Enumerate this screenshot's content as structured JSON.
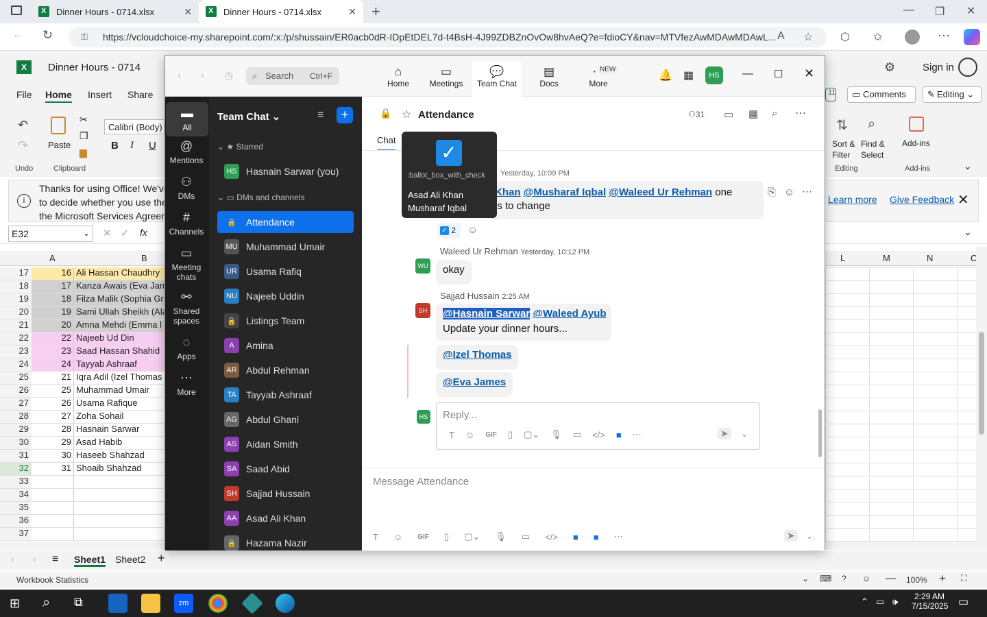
{
  "browser": {
    "tabs": [
      {
        "title": "Dinner Hours - 0714.xlsx"
      },
      {
        "title": "Dinner Hours - 0714.xlsx"
      }
    ],
    "url": "https://vcloudchoice-my.sharepoint.com/:x:/p/shussain/ER0acb0dR-IDpEtDEL7d-t4BsH-4J99ZDBZnOvOw8hvAeQ?e=fdioCY&nav=MTVfezAwMDAwMDAwL..."
  },
  "excel": {
    "title": "Dinner Hours - 0714",
    "signin": "Sign in",
    "menus": [
      "File",
      "Home",
      "Insert",
      "Share"
    ],
    "ribbon": {
      "undo": "Undo",
      "paste": "Paste",
      "clipboard": "Clipboard",
      "font": "Calibri (Body)",
      "sort_filter": "Sort & Filter",
      "find_select": "Find & Select",
      "editing_group": "Editing",
      "addins": "Add-ins",
      "addins_group": "Add-ins",
      "comments": "Comments",
      "editing": "Editing",
      "count_badge": "11"
    },
    "message": {
      "line1": "Thanks for using Office! We've",
      "line2": "to decide whether you use the",
      "line3": "the Microsoft Services Agreem",
      "learn_more": "Learn more",
      "feedback": "Give Feedback"
    },
    "namebox": "E32",
    "fx": "fx",
    "columns_left": [
      "A",
      "B"
    ],
    "columns_right": [
      "L",
      "M",
      "N",
      "C"
    ],
    "rows": [
      {
        "n": "17",
        "a": "16",
        "b": "Ali Hassan Chaudhry",
        "color": "#fde9a8"
      },
      {
        "n": "18",
        "a": "17",
        "b": "Kanza Awais (Eva Jam",
        "color": "#d0d0d0"
      },
      {
        "n": "19",
        "a": "18",
        "b": "Filza Malik (Sophia Gr",
        "color": "#d0d0d0"
      },
      {
        "n": "20",
        "a": "19",
        "b": "Sami Ullah Sheikh (Ala",
        "color": "#d0d0d0"
      },
      {
        "n": "21",
        "a": "20",
        "b": "Amna Mehdi (Emma l",
        "color": "#d0d0d0"
      },
      {
        "n": "22",
        "a": "22",
        "b": "Najeeb Ud Din",
        "color": "#f8cdf2"
      },
      {
        "n": "23",
        "a": "23",
        "b": "Saad Hassan Shahid",
        "color": "#f8cdf2"
      },
      {
        "n": "24",
        "a": "24",
        "b": "Tayyab Ashraaf",
        "color": "#f8cdf2"
      },
      {
        "n": "25",
        "a": "21",
        "b": "Iqra Adil (Izel Thomas",
        "color": "#ffffff"
      },
      {
        "n": "26",
        "a": "25",
        "b": "Muhammad Umair",
        "color": "#ffffff"
      },
      {
        "n": "27",
        "a": "26",
        "b": "Usama Rafique",
        "color": "#ffffff"
      },
      {
        "n": "28",
        "a": "27",
        "b": "Zoha Sohail",
        "color": "#ffffff"
      },
      {
        "n": "29",
        "a": "28",
        "b": "Hasnain Sarwar",
        "color": "#ffffff"
      },
      {
        "n": "30",
        "a": "29",
        "b": "Asad Habib",
        "color": "#ffffff"
      },
      {
        "n": "31",
        "a": "30",
        "b": "Haseeb Shahzad",
        "color": "#ffffff"
      },
      {
        "n": "32",
        "a": "31",
        "b": "Shoaib Shahzad",
        "color": "#ffffff"
      },
      {
        "n": "33",
        "a": "",
        "b": "",
        "color": "#ffffff"
      },
      {
        "n": "34",
        "a": "",
        "b": "",
        "color": "#ffffff"
      },
      {
        "n": "35",
        "a": "",
        "b": "",
        "color": "#ffffff"
      },
      {
        "n": "36",
        "a": "",
        "b": "",
        "color": "#ffffff"
      },
      {
        "n": "37",
        "a": "",
        "b": "",
        "color": "#ffffff"
      }
    ],
    "sheets": [
      "Sheet1",
      "Sheet2"
    ],
    "status": "Workbook Statistics",
    "zoom": "100%"
  },
  "zoom_app": {
    "search": "Search",
    "search_shortcut": "Ctrl+F",
    "nav": [
      "Home",
      "Meetings",
      "Team Chat",
      "Docs",
      "More"
    ],
    "new_badge": "NEW",
    "avatar": "HS",
    "rail": [
      "All",
      "Mentions",
      "DMs",
      "Channels",
      "Meeting chats",
      "Shared spaces",
      "Apps",
      "More"
    ],
    "list_title": "Team Chat",
    "starred_label": "Starred",
    "dms_label": "DMs and channels",
    "starred": [
      {
        "name": "Hasnain Sarwar (you)",
        "initials": "HS",
        "color": "#2e9e57"
      }
    ],
    "channels": [
      {
        "name": "Attendance",
        "initials": "",
        "color": "#0e71eb"
      },
      {
        "name": "Muhammad Umair",
        "initials": "MU",
        "color": "#555"
      },
      {
        "name": "Usama Rafiq",
        "initials": "UR",
        "color": "#3a5a86"
      },
      {
        "name": "Najeeb Uddin",
        "initials": "NU",
        "color": "#2a7fc4"
      },
      {
        "name": "Listings Team",
        "initials": "",
        "color": "#444"
      },
      {
        "name": "Amina",
        "initials": "A",
        "color": "#8b3fb0"
      },
      {
        "name": "Abdul Rehman",
        "initials": "AR",
        "color": "#7a5a40"
      },
      {
        "name": "Tayyab Ashraaf",
        "initials": "TA",
        "color": "#2a7fc4"
      },
      {
        "name": "Abdul Ghani",
        "initials": "AG",
        "color": "#666"
      },
      {
        "name": "Aidan Smith",
        "initials": "AS",
        "color": "#8b3fb0"
      },
      {
        "name": "Saad Abid",
        "initials": "SA",
        "color": "#8b3fb0"
      },
      {
        "name": "Sajjad Hussain",
        "initials": "SH",
        "color": "#c0392b"
      },
      {
        "name": "Asad Ali Khan",
        "initials": "AA",
        "color": "#8b3fb0"
      },
      {
        "name": "Hazama Nazir",
        "initials": "",
        "color": "#666"
      }
    ],
    "channel_title": "Attendance",
    "member_count": "31",
    "chat_tab": "Chat",
    "tooltip": {
      "code": ":ballot_box_with_check",
      "user1": "Asad Ali Khan",
      "user2": "Musharaf Iqbal"
    },
    "msg1": {
      "time": "Yesterday, 10:09 PM",
      "mention_a": "Khan",
      "mention_b": "@Musharaf Iqbal",
      "mention_c": "@Waleed Ur Rehman",
      "text_a": "one",
      "text_b": "ls to change",
      "reaction_count": "2"
    },
    "msg2": {
      "author": "Waleed Ur Rehman",
      "time": "Yesterday, 10:12 PM",
      "text": "okay",
      "initials": "WU"
    },
    "msg3": {
      "author": "Sajjad Hussain",
      "time": "2:25 AM",
      "initials": "SH",
      "mention_a": "@Hasnain Sarwar",
      "mention_b": "@Waleed Ayub",
      "text": "Update your dinner hours...",
      "mention_c": "@Izel Thomas",
      "mention_d": "@Eva James"
    },
    "reply_placeholder": "Reply...",
    "reply_avatar": "HS",
    "compose_placeholder": "Message Attendance"
  },
  "taskbar": {
    "time": "2:29 AM",
    "date": "7/15/2025"
  }
}
